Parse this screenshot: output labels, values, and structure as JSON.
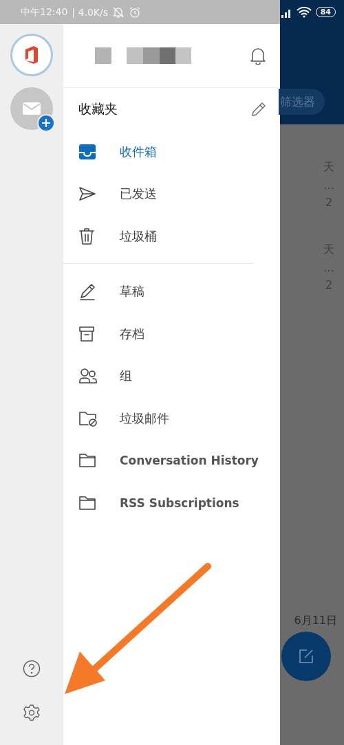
{
  "status_bar": {
    "time": "中午12:40",
    "speed": "| 4.0K/s",
    "battery": "84"
  },
  "rail": {
    "accounts": [
      {
        "kind": "office",
        "selected": true
      },
      {
        "kind": "add-mail",
        "selected": false
      }
    ]
  },
  "drawer": {
    "favorites_title": "收藏夹",
    "favorites": [
      {
        "label": "收件箱",
        "kind": "inbox",
        "selected": true
      },
      {
        "label": "已发送",
        "kind": "send",
        "selected": false
      },
      {
        "label": "垃圾桶",
        "kind": "trash",
        "selected": false
      }
    ],
    "folders": [
      {
        "label": "草稿",
        "kind": "draft",
        "selected": false
      },
      {
        "label": "存档",
        "kind": "archive",
        "selected": false
      },
      {
        "label": "组",
        "kind": "group",
        "selected": false
      },
      {
        "label": "垃圾邮件",
        "kind": "junk",
        "selected": false
      },
      {
        "label": "Conversation History",
        "kind": "folder",
        "selected": false
      },
      {
        "label": "RSS Subscriptions",
        "kind": "folder",
        "selected": false
      }
    ]
  },
  "background": {
    "filter_chip": "筛选器",
    "rows": [
      {
        "date": "天",
        "preview": "…",
        "count": "2"
      },
      {
        "date": "天",
        "preview": "…",
        "count": "2"
      }
    ],
    "last_date": "6月11日"
  }
}
